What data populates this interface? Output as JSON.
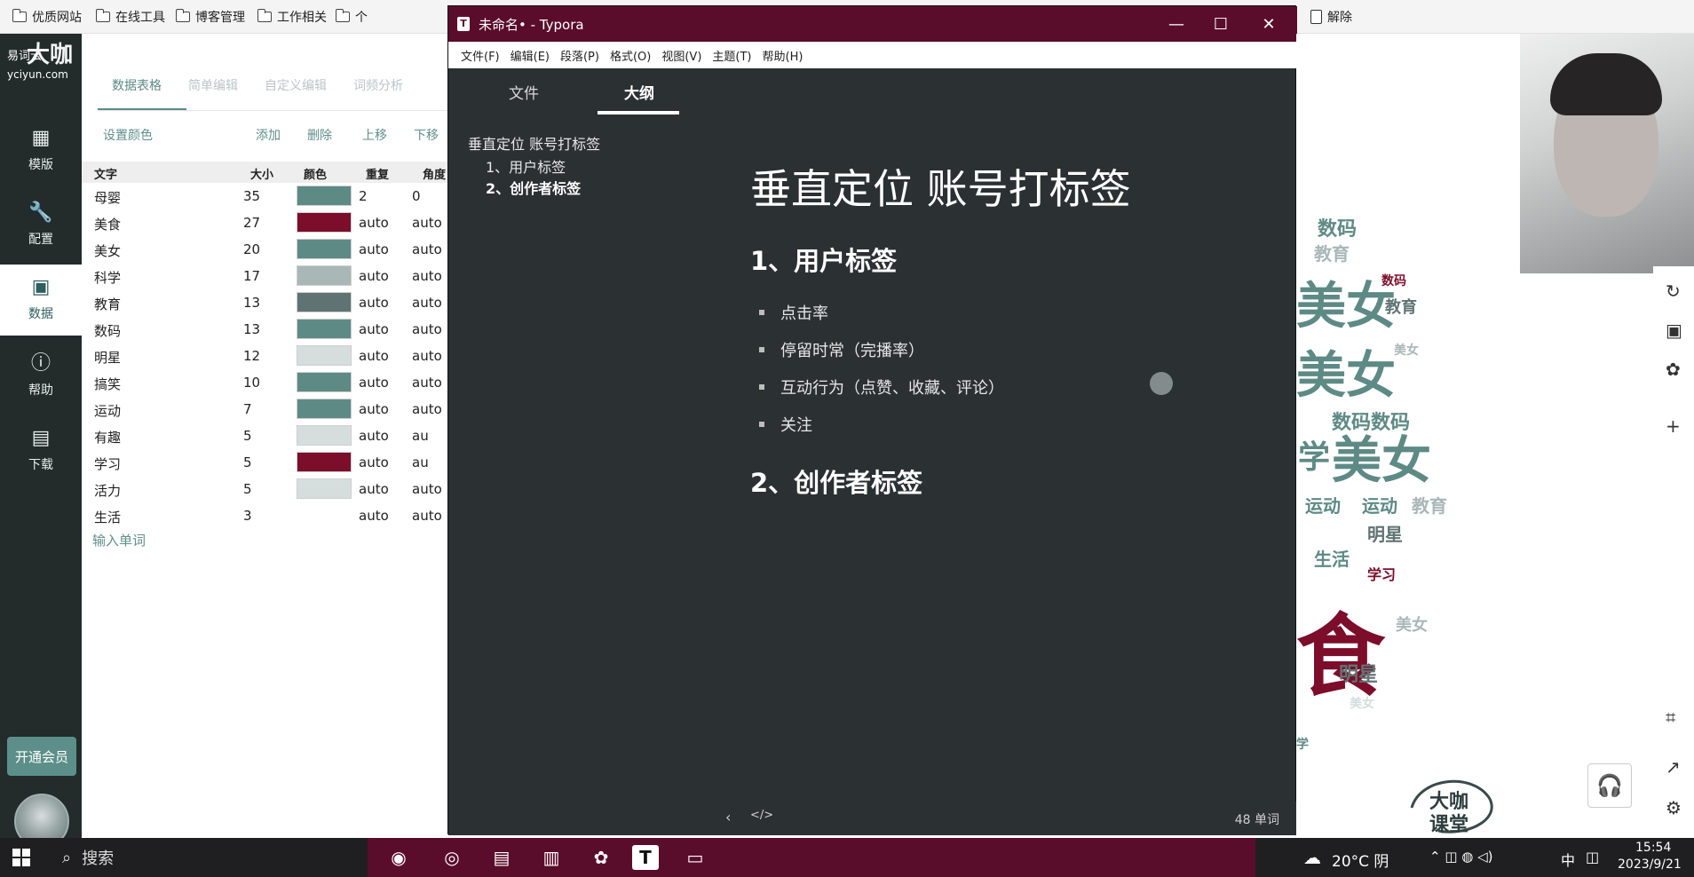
{
  "bookmarks": [
    {
      "label": "优质网站"
    },
    {
      "label": "在线工具"
    },
    {
      "label": "博客管理"
    },
    {
      "label": "工作相关"
    },
    {
      "label": "个"
    },
    {
      "label": "解除"
    }
  ],
  "app": {
    "brand_line1": "易词云",
    "brand_big": "大咖",
    "brand_site": "yciyun.com",
    "nav": [
      {
        "label": "模版",
        "icon": "template-icon"
      },
      {
        "label": "配置",
        "icon": "wrench-icon"
      },
      {
        "label": "数据",
        "icon": "inbox-icon"
      },
      {
        "label": "帮助",
        "icon": "help-icon"
      },
      {
        "label": "下载",
        "icon": "save-icon"
      }
    ],
    "vip_label": "开通会员"
  },
  "editor": {
    "tabs": [
      "数据表格",
      "简单编辑",
      "自定义编辑",
      "词频分析"
    ],
    "tools": {
      "color": "设置颜色",
      "add": "添加",
      "delete": "删除",
      "up": "上移",
      "down": "下移"
    },
    "headers": {
      "word": "文字",
      "size": "大小",
      "color": "颜色",
      "repeat": "重复",
      "angle": "角度"
    },
    "rows": [
      {
        "word": "母婴",
        "size": "35",
        "color": "#5e8a86",
        "repeat": "2",
        "angle": "0"
      },
      {
        "word": "美食",
        "size": "27",
        "color": "#7c0d2b",
        "repeat": "auto",
        "angle": "auto"
      },
      {
        "word": "美女",
        "size": "20",
        "color": "#5e8a86",
        "repeat": "auto",
        "angle": "auto"
      },
      {
        "word": "科学",
        "size": "17",
        "color": "#a9b8b6",
        "repeat": "auto",
        "angle": "auto"
      },
      {
        "word": "教育",
        "size": "13",
        "color": "#5f7472",
        "repeat": "auto",
        "angle": "auto"
      },
      {
        "word": "数码",
        "size": "13",
        "color": "#5e8a86",
        "repeat": "auto",
        "angle": "auto"
      },
      {
        "word": "明星",
        "size": "12",
        "color": "#d5dedd",
        "repeat": "auto",
        "angle": "auto"
      },
      {
        "word": "搞笑",
        "size": "10",
        "color": "#5e8a86",
        "repeat": "auto",
        "angle": "auto"
      },
      {
        "word": "运动",
        "size": "7",
        "color": "#5e8a86",
        "repeat": "auto",
        "angle": "auto"
      },
      {
        "word": "有趣",
        "size": "5",
        "color": "#d5dedd",
        "repeat": "auto",
        "angle": "au"
      },
      {
        "word": "学习",
        "size": "5",
        "color": "#7c0d2b",
        "repeat": "auto",
        "angle": "au"
      },
      {
        "word": "活力",
        "size": "5",
        "color": "#d5dedd",
        "repeat": "auto",
        "angle": "auto"
      },
      {
        "word": "生活",
        "size": "3",
        "color": "",
        "repeat": "auto",
        "angle": "auto"
      }
    ],
    "input_placeholder": "输入单词"
  },
  "typora": {
    "title": "未命名• - Typora",
    "menu": [
      "文件(F)",
      "编辑(E)",
      "段落(P)",
      "格式(O)",
      "视图(V)",
      "主题(T)",
      "帮助(H)"
    ],
    "sidebar_tabs": [
      "文件",
      "大纲"
    ],
    "outline": [
      "垂直定位 账号打标签",
      "1、用户标签",
      "2、创作者标签"
    ],
    "doc": {
      "h1": "垂直定位 账号打标签",
      "h2a": "1、用户标签",
      "items": [
        "点击率",
        "停留时常（完播率）",
        "互动行为（点赞、收藏、评论）",
        "关注"
      ],
      "h2b": "2、创作者标签"
    },
    "word_count": "48 单词"
  },
  "cloud_words": [
    {
      "t": "数码",
      "c": "#5e8a86"
    },
    {
      "t": "教育",
      "c": "#a9b8b6"
    },
    {
      "t": "美女",
      "c": "#5e8a86"
    },
    {
      "t": "数码",
      "c": "#7c0d2b"
    },
    {
      "t": "教育",
      "c": "#5f7472"
    },
    {
      "t": "美女",
      "c": "#5e8a86"
    },
    {
      "t": "美女",
      "c": "#a9b8b6"
    },
    {
      "t": "数码数码",
      "c": "#5e8a86"
    },
    {
      "t": "学",
      "c": "#5e8a86"
    },
    {
      "t": "美女",
      "c": "#5e8a86"
    },
    {
      "t": "运动",
      "c": "#5e8a86"
    },
    {
      "t": "运动",
      "c": "#5e8a86"
    },
    {
      "t": "教育",
      "c": "#a9b8b6"
    },
    {
      "t": "明星",
      "c": "#5f7472"
    },
    {
      "t": "生活",
      "c": "#5e8a86"
    },
    {
      "t": "学习",
      "c": "#7c0d2b"
    },
    {
      "t": "食",
      "c": "#7c0d2b"
    },
    {
      "t": "美女",
      "c": "#a9b8b6"
    },
    {
      "t": "明星",
      "c": "#5f7472"
    },
    {
      "t": "美女",
      "c": "#d5dedd"
    },
    {
      "t": "学",
      "c": "#5e8a86"
    }
  ],
  "brand_watermark": "大咖课堂",
  "taskbar": {
    "search_label": "搜索",
    "weather": "20°C 阴",
    "ime": "中",
    "time": "15:54",
    "date": "2023/9/21"
  },
  "colors": {
    "accent": "#5e8a86",
    "typora_titlebar": "#5a0d2a",
    "typora_bg": "#2b3033"
  }
}
